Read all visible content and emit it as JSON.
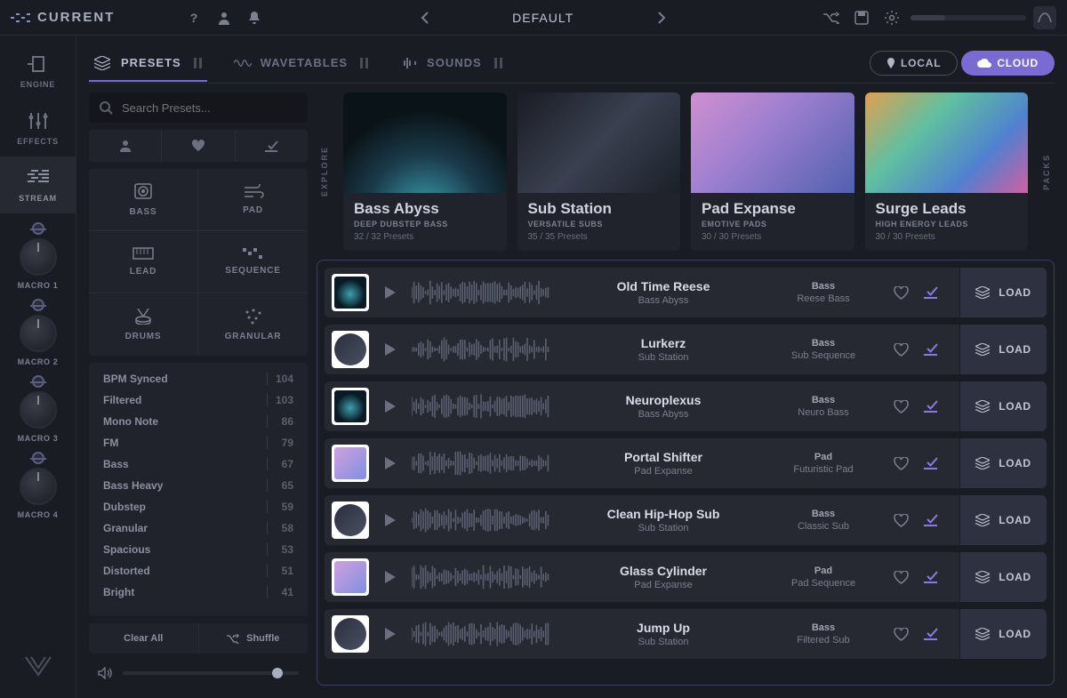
{
  "app": {
    "name": "CURRENT",
    "preset_title": "DEFAULT"
  },
  "rail": {
    "engine": "ENGINE",
    "effects": "EFFECTS",
    "stream": "STREAM",
    "macros": [
      "MACRO 1",
      "MACRO 2",
      "MACRO 3",
      "MACRO 4"
    ]
  },
  "tabs": {
    "presets": "PRESETS",
    "wavetables": "WAVETABLES",
    "sounds": "SOUNDS"
  },
  "location": {
    "local": "LOCAL",
    "cloud": "CLOUD"
  },
  "search": {
    "placeholder": "Search Presets..."
  },
  "categories": [
    "BASS",
    "PAD",
    "LEAD",
    "SEQUENCE",
    "DRUMS",
    "GRANULAR"
  ],
  "tags": [
    {
      "name": "BPM Synced",
      "count": "104"
    },
    {
      "name": "Filtered",
      "count": "103"
    },
    {
      "name": "Mono Note",
      "count": "86"
    },
    {
      "name": "FM",
      "count": "79"
    },
    {
      "name": "Bass",
      "count": "67"
    },
    {
      "name": "Bass Heavy",
      "count": "65"
    },
    {
      "name": "Dubstep",
      "count": "59"
    },
    {
      "name": "Granular",
      "count": "58"
    },
    {
      "name": "Spacious",
      "count": "53"
    },
    {
      "name": "Distorted",
      "count": "51"
    },
    {
      "name": "Bright",
      "count": "41"
    }
  ],
  "filter_actions": {
    "clear": "Clear All",
    "shuffle": "Shuffle"
  },
  "pack_labels": {
    "explore": "EXPLORE",
    "packs": "PACKS"
  },
  "packs": [
    {
      "title": "Bass Abyss",
      "sub": "DEEP DUBSTEP BASS",
      "count": "32 / 32 Presets"
    },
    {
      "title": "Sub Station",
      "sub": "VERSATILE SUBS",
      "count": "35 / 35 Presets"
    },
    {
      "title": "Pad Expanse",
      "sub": "EMOTIVE PADS",
      "count": "30 / 30 Presets"
    },
    {
      "title": "Surge Leads",
      "sub": "HIGH ENERGY LEADS",
      "count": "30 / 30 Presets"
    }
  ],
  "load_label": "LOAD",
  "presets": [
    {
      "name": "Old Time Reese",
      "pack": "Bass Abyss",
      "cat": "Bass",
      "tag": "Reese Bass",
      "thumb": "t1"
    },
    {
      "name": "Lurkerz",
      "pack": "Sub Station",
      "cat": "Bass",
      "tag": "Sub Sequence",
      "thumb": "t2"
    },
    {
      "name": "Neuroplexus",
      "pack": "Bass Abyss",
      "cat": "Bass",
      "tag": "Neuro Bass",
      "thumb": "t1"
    },
    {
      "name": "Portal Shifter",
      "pack": "Pad Expanse",
      "cat": "Pad",
      "tag": "Futuristic Pad",
      "thumb": "t3"
    },
    {
      "name": "Clean Hip-Hop Sub",
      "pack": "Sub Station",
      "cat": "Bass",
      "tag": "Classic Sub",
      "thumb": "t2"
    },
    {
      "name": "Glass Cylinder",
      "pack": "Pad Expanse",
      "cat": "Pad",
      "tag": "Pad Sequence",
      "thumb": "t3"
    },
    {
      "name": "Jump Up",
      "pack": "Sub Station",
      "cat": "Bass",
      "tag": "Filtered Sub",
      "thumb": "t2"
    }
  ]
}
